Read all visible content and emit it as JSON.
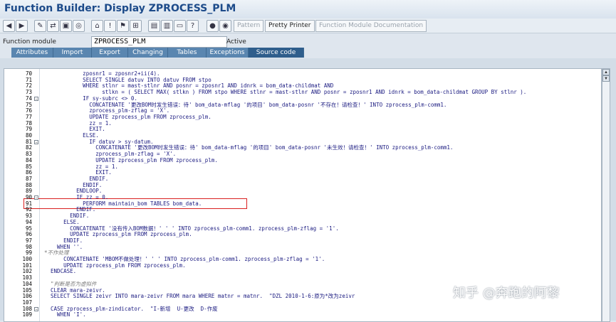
{
  "window": {
    "title": "Function Builder: Display ZPROCESS_PLM"
  },
  "toolbar": {
    "icons": [
      "back-icon",
      "forward-icon",
      "edit-icon",
      "display-change-icon",
      "other-object-icon",
      "active-inactive-icon",
      "where-used-icon",
      "check-icon",
      "activate-icon",
      "test-icon",
      "where-used-list-icon",
      "display-object-list-icon",
      "enhancement-icon",
      "help-icon",
      "breakpoint-icon",
      "session-breakpoint-icon"
    ],
    "pattern_label": "Pattern",
    "pretty_printer_label": "Pretty Printer",
    "fm_doc_label": "Function Module Documentation"
  },
  "header": {
    "function_module_label": "Function module",
    "function_module_value": "ZPROCESS_PLM",
    "status": "Active"
  },
  "tabs": [
    {
      "label": "Attributes",
      "active": false
    },
    {
      "label": "Import",
      "active": false
    },
    {
      "label": "Export",
      "active": false
    },
    {
      "label": "Changing",
      "active": false
    },
    {
      "label": "Tables",
      "active": false
    },
    {
      "label": "Exceptions",
      "active": false
    },
    {
      "label": "Source code",
      "active": true
    }
  ],
  "code": {
    "highlighted_line": "91",
    "lines": [
      {
        "n": "70",
        "fold": false,
        "t": "            zposnr1 = zposnr2+ii(4)."
      },
      {
        "n": "71",
        "fold": false,
        "t": "            SELECT SINGLE datuv INTO datuv FROM stpo"
      },
      {
        "n": "72",
        "fold": false,
        "t": "            WHERE stlnr = mast-stlnr AND posnr = zposnr1 AND idnrk = bom_data-childmat AND"
      },
      {
        "n": "73",
        "fold": false,
        "t": "                  stlkn = ( SELECT MAX( stlkn ) FROM stpo WHERE stlnr = mast-stlnr AND posnr = zposnr1 AND idnrk = bom_data-childmat GROUP BY stlnr )."
      },
      {
        "n": "74",
        "fold": true,
        "t": "            IF sy-subrc <> 0."
      },
      {
        "n": "75",
        "fold": false,
        "t": "              CONCATENATE '更改BOM时发生错误：待' bom_data-mflag '的项目' bom_data-posnr '不存在！请检查！' INTO zprocess_plm-comm1."
      },
      {
        "n": "76",
        "fold": false,
        "t": "              zprocess_plm-zflag = 'X'."
      },
      {
        "n": "77",
        "fold": false,
        "t": "              UPDATE zprocess_plm FROM zprocess_plm."
      },
      {
        "n": "78",
        "fold": false,
        "t": "              zz = 1."
      },
      {
        "n": "79",
        "fold": false,
        "t": "              EXIT."
      },
      {
        "n": "80",
        "fold": false,
        "t": "            ELSE."
      },
      {
        "n": "81",
        "fold": true,
        "t": "              IF datuv > sy-datum."
      },
      {
        "n": "82",
        "fold": false,
        "t": "                CONCATENATE '更改BOM时发生错误：待' bom_data-mflag '的项目' bom_data-posnr '未生效！请检查！' INTO zprocess_plm-comm1."
      },
      {
        "n": "83",
        "fold": false,
        "t": "                zprocess_plm-zflag = 'X'."
      },
      {
        "n": "84",
        "fold": false,
        "t": "                UPDATE zprocess_plm FROM zprocess_plm."
      },
      {
        "n": "85",
        "fold": false,
        "t": "                zz = 1."
      },
      {
        "n": "86",
        "fold": false,
        "t": "                EXIT."
      },
      {
        "n": "87",
        "fold": false,
        "t": "              ENDIF."
      },
      {
        "n": "88",
        "fold": false,
        "t": "            ENDIF."
      },
      {
        "n": "89",
        "fold": false,
        "t": "          ENDLOOP."
      },
      {
        "n": "90",
        "fold": true,
        "t": "          IF zz = 0."
      },
      {
        "n": "91",
        "fold": false,
        "t": "            PERFORM maintain_bom TABLES bom_data."
      },
      {
        "n": "92",
        "fold": false,
        "t": "          ENDIF."
      },
      {
        "n": "93",
        "fold": false,
        "t": "        ENDIF."
      },
      {
        "n": "94",
        "fold": false,
        "t": "      ELSE."
      },
      {
        "n": "95",
        "fold": false,
        "t": "        CONCATENATE '没有传入BOM数据！' ' ' INTO zprocess_plm-comm1. zprocess_plm-zflag = '1'."
      },
      {
        "n": "96",
        "fold": false,
        "t": "        UPDATE zprocess_plm FROM zprocess_plm."
      },
      {
        "n": "97",
        "fold": false,
        "t": "      ENDIF."
      },
      {
        "n": "98",
        "fold": false,
        "t": "    WHEN ''."
      },
      {
        "n": "99",
        "fold": false,
        "t": "*不作处理"
      },
      {
        "n": "100",
        "fold": false,
        "t": "      CONCATENATE 'MBOM不做处理！' ' ' INTO zprocess_plm-comm1. zprocess_plm-zflag = '1'."
      },
      {
        "n": "101",
        "fold": false,
        "t": "      UPDATE zprocess_plm FROM zprocess_plm."
      },
      {
        "n": "102",
        "fold": false,
        "t": "  ENDCASE."
      },
      {
        "n": "103",
        "fold": false,
        "t": ""
      },
      {
        "n": "104",
        "fold": false,
        "t": "  \"判断是否为虚拟件"
      },
      {
        "n": "105",
        "fold": false,
        "t": "  CLEAR mara-zeivr."
      },
      {
        "n": "106",
        "fold": false,
        "t": "  SELECT SINGLE zeivr INTO mara-zeivr FROM mara WHERE matnr = matnr.  \"DZL 2010-1-6:原为*改为zeivr"
      },
      {
        "n": "107",
        "fold": false,
        "t": ""
      },
      {
        "n": "108",
        "fold": true,
        "t": "  CASE zprocess_plm-zindicator.  \"I-新增  U-更改  D-作废"
      },
      {
        "n": "109",
        "fold": false,
        "t": "    WHEN 'I'."
      }
    ]
  },
  "watermark": "知乎 @奔跑的阿黎"
}
